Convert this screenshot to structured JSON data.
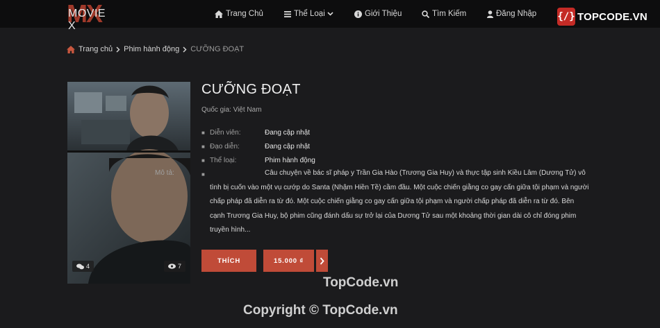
{
  "header": {
    "logo_text": "MOVIE X",
    "logo_mark": "MX",
    "nav": [
      {
        "label": "Trang Chủ",
        "icon": "home-icon"
      },
      {
        "label": "Thể Loại",
        "icon": "list-icon"
      },
      {
        "label": "Giới Thiệu",
        "icon": "info-icon"
      },
      {
        "label": "Tìm Kiếm",
        "icon": "search-icon"
      },
      {
        "label": "Đăng Nhập",
        "icon": "user-icon"
      }
    ],
    "brand": "TOPCODE.VN"
  },
  "breadcrumb": [
    "Trang chủ",
    "Phim hành động",
    "CƯỠNG ĐOẠT"
  ],
  "movie": {
    "title": "CƯỠNG ĐOẠT",
    "country": "Quốc gia: Việt Nam",
    "details": [
      {
        "label": "Diễn viên:",
        "value": "Đang cập nhật"
      },
      {
        "label": "Đạo diễn:",
        "value": "Đang cập nhật"
      },
      {
        "label": "Thể loại:",
        "value": "Phim hành động"
      }
    ],
    "description_label": "Mô tả:",
    "description": "Câu chuyện về bác sĩ pháp y Trần Gia Hào (Trương Gia Huy) và thực tập sinh Kiều Lâm (Dương Tử) vô tình bị cuốn vào một vụ cướp do Santa (Nhậm Hiền Tề) cầm đầu. Một cuộc chiến giằng co gay cấn giữa tội phạm và người chấp pháp đã diễn ra từ đó. Một cuộc chiến giằng co gay cấn giữa tội phạm và người chấp pháp đã diễn ra từ đó. Bên cạnh Trương Gia Huy, bộ phim cũng đánh dấu sự trở lại của Dương Tử sau một khoảng thời gian dài cô chỉ đóng phim truyền hình...",
    "comments": "4",
    "views": "7"
  },
  "actions": {
    "like": "THÍCH",
    "price": "15.000 ₫"
  },
  "watermarks": {
    "site": "TopCode.vn",
    "copyright": "Copyright © TopCode.vn"
  },
  "colors": {
    "accent": "#c04b38",
    "background": "#1b1b1d",
    "topbar": "#0d0d0e"
  }
}
